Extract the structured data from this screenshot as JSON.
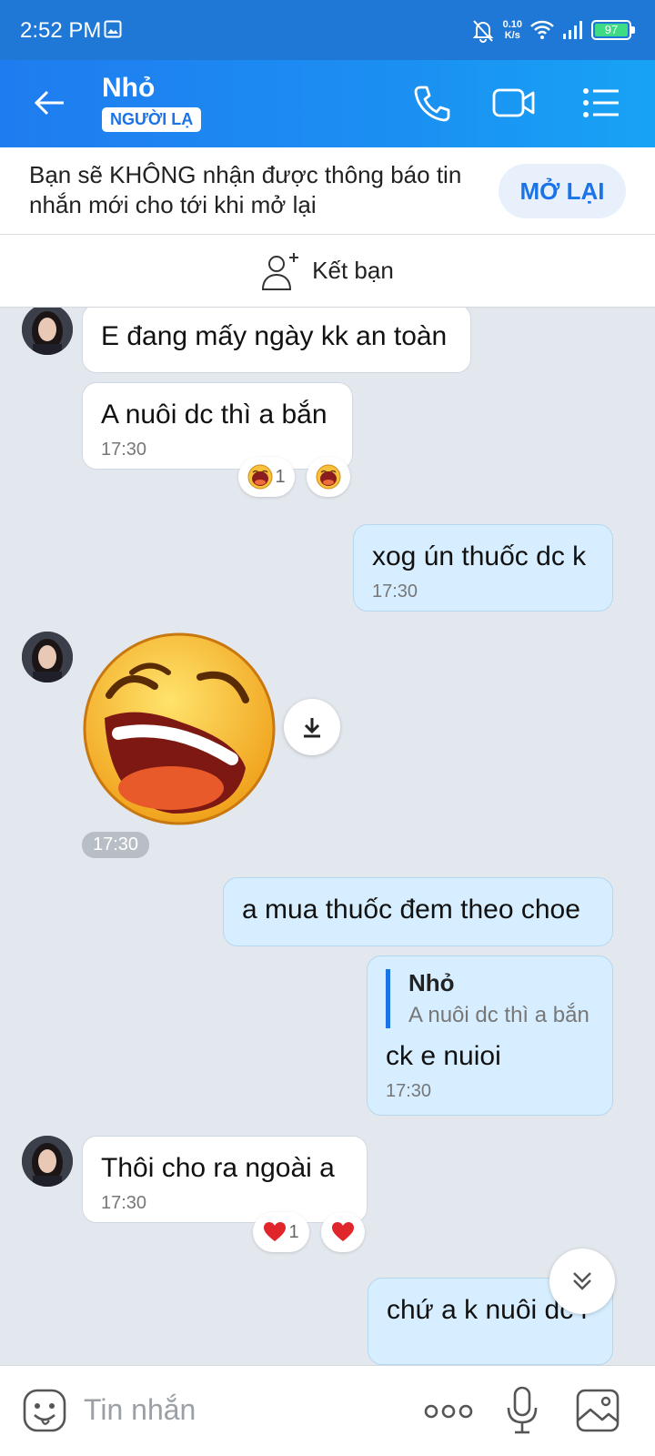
{
  "status_bar": {
    "time": "2:52 PM",
    "net_speed_value": "0.10",
    "net_speed_unit": "K/s",
    "battery": "97"
  },
  "header": {
    "name": "Nhỏ",
    "badge": "NGƯỜI LẠ"
  },
  "notice": {
    "text": "Bạn sẽ KHÔNG nhận được thông báo tin nhắn mới cho tới khi mở lại",
    "button": "MỞ LẠI"
  },
  "add_friend": {
    "label": "Kết bạn"
  },
  "messages": [
    {
      "dir": "in",
      "text": "E đang mấy ngày kk an toàn"
    },
    {
      "dir": "in",
      "text": "A nuôi dc thì a bắn",
      "time": "17:30",
      "reaction_count": "1",
      "reaction_icon": "laughing-emoji-icon"
    },
    {
      "dir": "out",
      "text": "xog ún thuốc dc k",
      "time": "17:30"
    },
    {
      "dir": "in",
      "sticker": "laughing-face-sticker",
      "time": "17:30"
    },
    {
      "dir": "out",
      "text": "a mua thuốc đem theo choe"
    },
    {
      "dir": "out",
      "quote_name": "Nhỏ",
      "quote_text": "A nuôi dc thì a bắn",
      "text": "ck e nuioi",
      "time": "17:30"
    },
    {
      "dir": "in",
      "text": "Thôi cho ra ngoài a",
      "time": "17:30",
      "reaction_count": "1",
      "reaction_icon": "heart-icon"
    },
    {
      "dir": "out",
      "text": "chứ a k nuôi dc r"
    }
  ],
  "input": {
    "placeholder": "Tin nhắn"
  },
  "colors": {
    "header": "#1f7cf0",
    "accent": "#1a73e8",
    "outgoing_bubble": "#d6eeff",
    "chat_bg": "#e3e8ee"
  }
}
